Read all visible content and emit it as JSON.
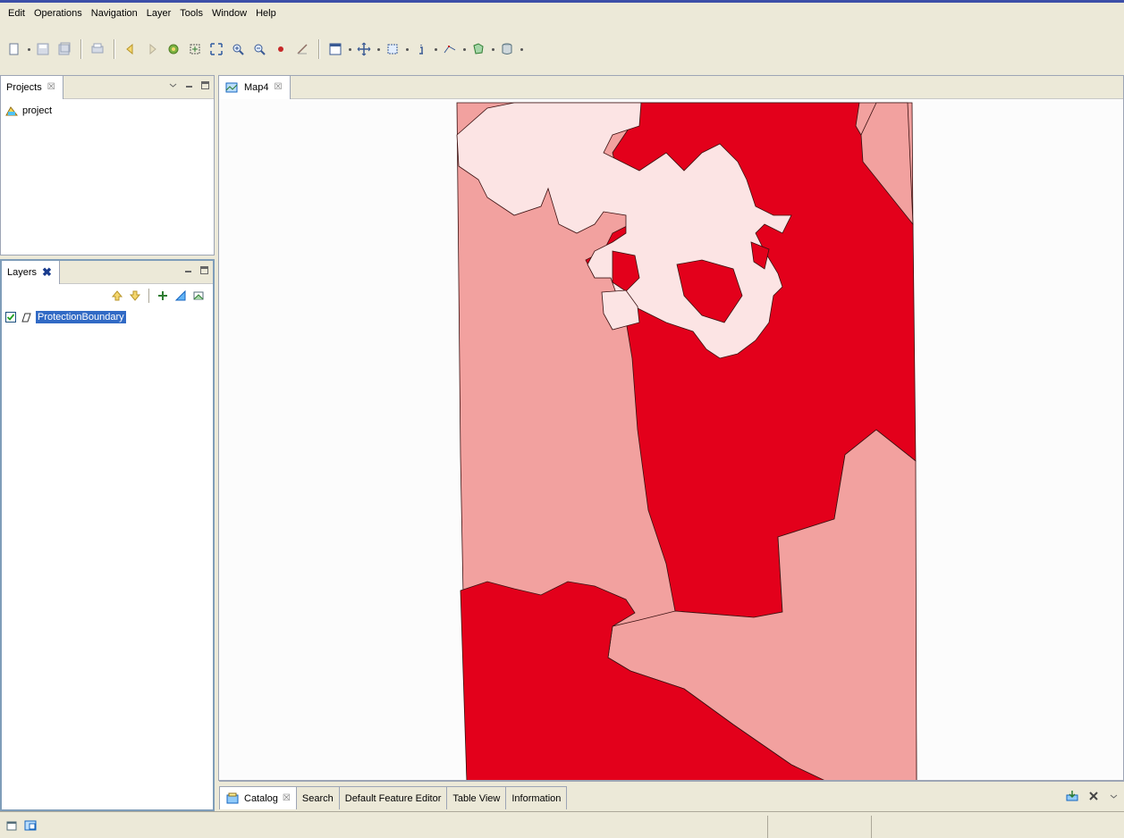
{
  "menubar": {
    "items": [
      "Edit",
      "Operations",
      "Navigation",
      "Layer",
      "Tools",
      "Window",
      "Help"
    ]
  },
  "projects_panel": {
    "tab_label": "Projects",
    "close_glyph": "☒",
    "items": [
      {
        "label": "project",
        "icon": "project-icon"
      }
    ]
  },
  "layers_panel": {
    "tab_label": "Layers",
    "close_glyph": "✖",
    "layers": [
      {
        "name": "ProtectionBoundary",
        "checked": true
      }
    ]
  },
  "map_editor": {
    "tab_label": "Map4",
    "close_glyph": "☒",
    "colors": {
      "dark": "#e3001b",
      "medium": "#f2a19f",
      "light": "#fce4e4",
      "background": "#fcfcfc"
    }
  },
  "bottom_tabs": {
    "catalog_close": "☒",
    "tabs": [
      "Catalog",
      "Search",
      "Default Feature Editor",
      "Table View",
      "Information"
    ]
  }
}
